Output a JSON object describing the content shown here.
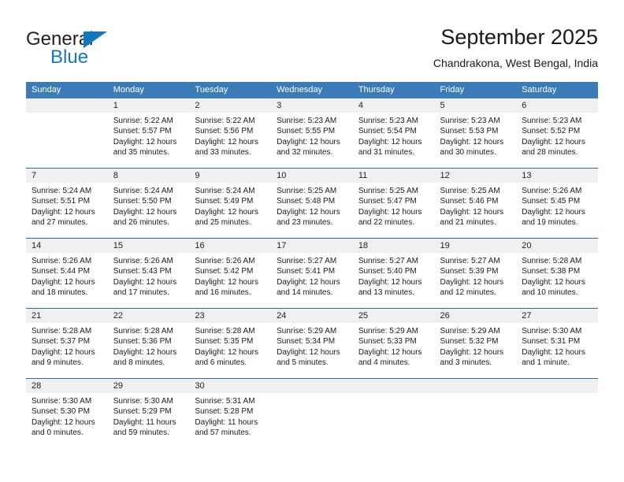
{
  "brand": {
    "name_top": "General",
    "name_bottom": "Blue",
    "accent_color": "#1278be"
  },
  "header": {
    "title": "September 2025",
    "subtitle": "Chandrakona, West Bengal, India"
  },
  "calendar": {
    "header_bg": "#3b7cb8",
    "daynum_bg": "#f0f0f0",
    "row_divider_color": "#2e6da4",
    "weekdays": [
      "Sunday",
      "Monday",
      "Tuesday",
      "Wednesday",
      "Thursday",
      "Friday",
      "Saturday"
    ],
    "weeks": [
      [
        {
          "day": "",
          "lines": []
        },
        {
          "day": "1",
          "lines": [
            "Sunrise: 5:22 AM",
            "Sunset: 5:57 PM",
            "Daylight: 12 hours",
            "and 35 minutes."
          ]
        },
        {
          "day": "2",
          "lines": [
            "Sunrise: 5:22 AM",
            "Sunset: 5:56 PM",
            "Daylight: 12 hours",
            "and 33 minutes."
          ]
        },
        {
          "day": "3",
          "lines": [
            "Sunrise: 5:23 AM",
            "Sunset: 5:55 PM",
            "Daylight: 12 hours",
            "and 32 minutes."
          ]
        },
        {
          "day": "4",
          "lines": [
            "Sunrise: 5:23 AM",
            "Sunset: 5:54 PM",
            "Daylight: 12 hours",
            "and 31 minutes."
          ]
        },
        {
          "day": "5",
          "lines": [
            "Sunrise: 5:23 AM",
            "Sunset: 5:53 PM",
            "Daylight: 12 hours",
            "and 30 minutes."
          ]
        },
        {
          "day": "6",
          "lines": [
            "Sunrise: 5:23 AM",
            "Sunset: 5:52 PM",
            "Daylight: 12 hours",
            "and 28 minutes."
          ]
        }
      ],
      [
        {
          "day": "7",
          "lines": [
            "Sunrise: 5:24 AM",
            "Sunset: 5:51 PM",
            "Daylight: 12 hours",
            "and 27 minutes."
          ]
        },
        {
          "day": "8",
          "lines": [
            "Sunrise: 5:24 AM",
            "Sunset: 5:50 PM",
            "Daylight: 12 hours",
            "and 26 minutes."
          ]
        },
        {
          "day": "9",
          "lines": [
            "Sunrise: 5:24 AM",
            "Sunset: 5:49 PM",
            "Daylight: 12 hours",
            "and 25 minutes."
          ]
        },
        {
          "day": "10",
          "lines": [
            "Sunrise: 5:25 AM",
            "Sunset: 5:48 PM",
            "Daylight: 12 hours",
            "and 23 minutes."
          ]
        },
        {
          "day": "11",
          "lines": [
            "Sunrise: 5:25 AM",
            "Sunset: 5:47 PM",
            "Daylight: 12 hours",
            "and 22 minutes."
          ]
        },
        {
          "day": "12",
          "lines": [
            "Sunrise: 5:25 AM",
            "Sunset: 5:46 PM",
            "Daylight: 12 hours",
            "and 21 minutes."
          ]
        },
        {
          "day": "13",
          "lines": [
            "Sunrise: 5:26 AM",
            "Sunset: 5:45 PM",
            "Daylight: 12 hours",
            "and 19 minutes."
          ]
        }
      ],
      [
        {
          "day": "14",
          "lines": [
            "Sunrise: 5:26 AM",
            "Sunset: 5:44 PM",
            "Daylight: 12 hours",
            "and 18 minutes."
          ]
        },
        {
          "day": "15",
          "lines": [
            "Sunrise: 5:26 AM",
            "Sunset: 5:43 PM",
            "Daylight: 12 hours",
            "and 17 minutes."
          ]
        },
        {
          "day": "16",
          "lines": [
            "Sunrise: 5:26 AM",
            "Sunset: 5:42 PM",
            "Daylight: 12 hours",
            "and 16 minutes."
          ]
        },
        {
          "day": "17",
          "lines": [
            "Sunrise: 5:27 AM",
            "Sunset: 5:41 PM",
            "Daylight: 12 hours",
            "and 14 minutes."
          ]
        },
        {
          "day": "18",
          "lines": [
            "Sunrise: 5:27 AM",
            "Sunset: 5:40 PM",
            "Daylight: 12 hours",
            "and 13 minutes."
          ]
        },
        {
          "day": "19",
          "lines": [
            "Sunrise: 5:27 AM",
            "Sunset: 5:39 PM",
            "Daylight: 12 hours",
            "and 12 minutes."
          ]
        },
        {
          "day": "20",
          "lines": [
            "Sunrise: 5:28 AM",
            "Sunset: 5:38 PM",
            "Daylight: 12 hours",
            "and 10 minutes."
          ]
        }
      ],
      [
        {
          "day": "21",
          "lines": [
            "Sunrise: 5:28 AM",
            "Sunset: 5:37 PM",
            "Daylight: 12 hours",
            "and 9 minutes."
          ]
        },
        {
          "day": "22",
          "lines": [
            "Sunrise: 5:28 AM",
            "Sunset: 5:36 PM",
            "Daylight: 12 hours",
            "and 8 minutes."
          ]
        },
        {
          "day": "23",
          "lines": [
            "Sunrise: 5:28 AM",
            "Sunset: 5:35 PM",
            "Daylight: 12 hours",
            "and 6 minutes."
          ]
        },
        {
          "day": "24",
          "lines": [
            "Sunrise: 5:29 AM",
            "Sunset: 5:34 PM",
            "Daylight: 12 hours",
            "and 5 minutes."
          ]
        },
        {
          "day": "25",
          "lines": [
            "Sunrise: 5:29 AM",
            "Sunset: 5:33 PM",
            "Daylight: 12 hours",
            "and 4 minutes."
          ]
        },
        {
          "day": "26",
          "lines": [
            "Sunrise: 5:29 AM",
            "Sunset: 5:32 PM",
            "Daylight: 12 hours",
            "and 3 minutes."
          ]
        },
        {
          "day": "27",
          "lines": [
            "Sunrise: 5:30 AM",
            "Sunset: 5:31 PM",
            "Daylight: 12 hours",
            "and 1 minute."
          ]
        }
      ],
      [
        {
          "day": "28",
          "lines": [
            "Sunrise: 5:30 AM",
            "Sunset: 5:30 PM",
            "Daylight: 12 hours",
            "and 0 minutes."
          ]
        },
        {
          "day": "29",
          "lines": [
            "Sunrise: 5:30 AM",
            "Sunset: 5:29 PM",
            "Daylight: 11 hours",
            "and 59 minutes."
          ]
        },
        {
          "day": "30",
          "lines": [
            "Sunrise: 5:31 AM",
            "Sunset: 5:28 PM",
            "Daylight: 11 hours",
            "and 57 minutes."
          ]
        },
        {
          "day": "",
          "lines": []
        },
        {
          "day": "",
          "lines": []
        },
        {
          "day": "",
          "lines": []
        },
        {
          "day": "",
          "lines": []
        }
      ]
    ]
  }
}
